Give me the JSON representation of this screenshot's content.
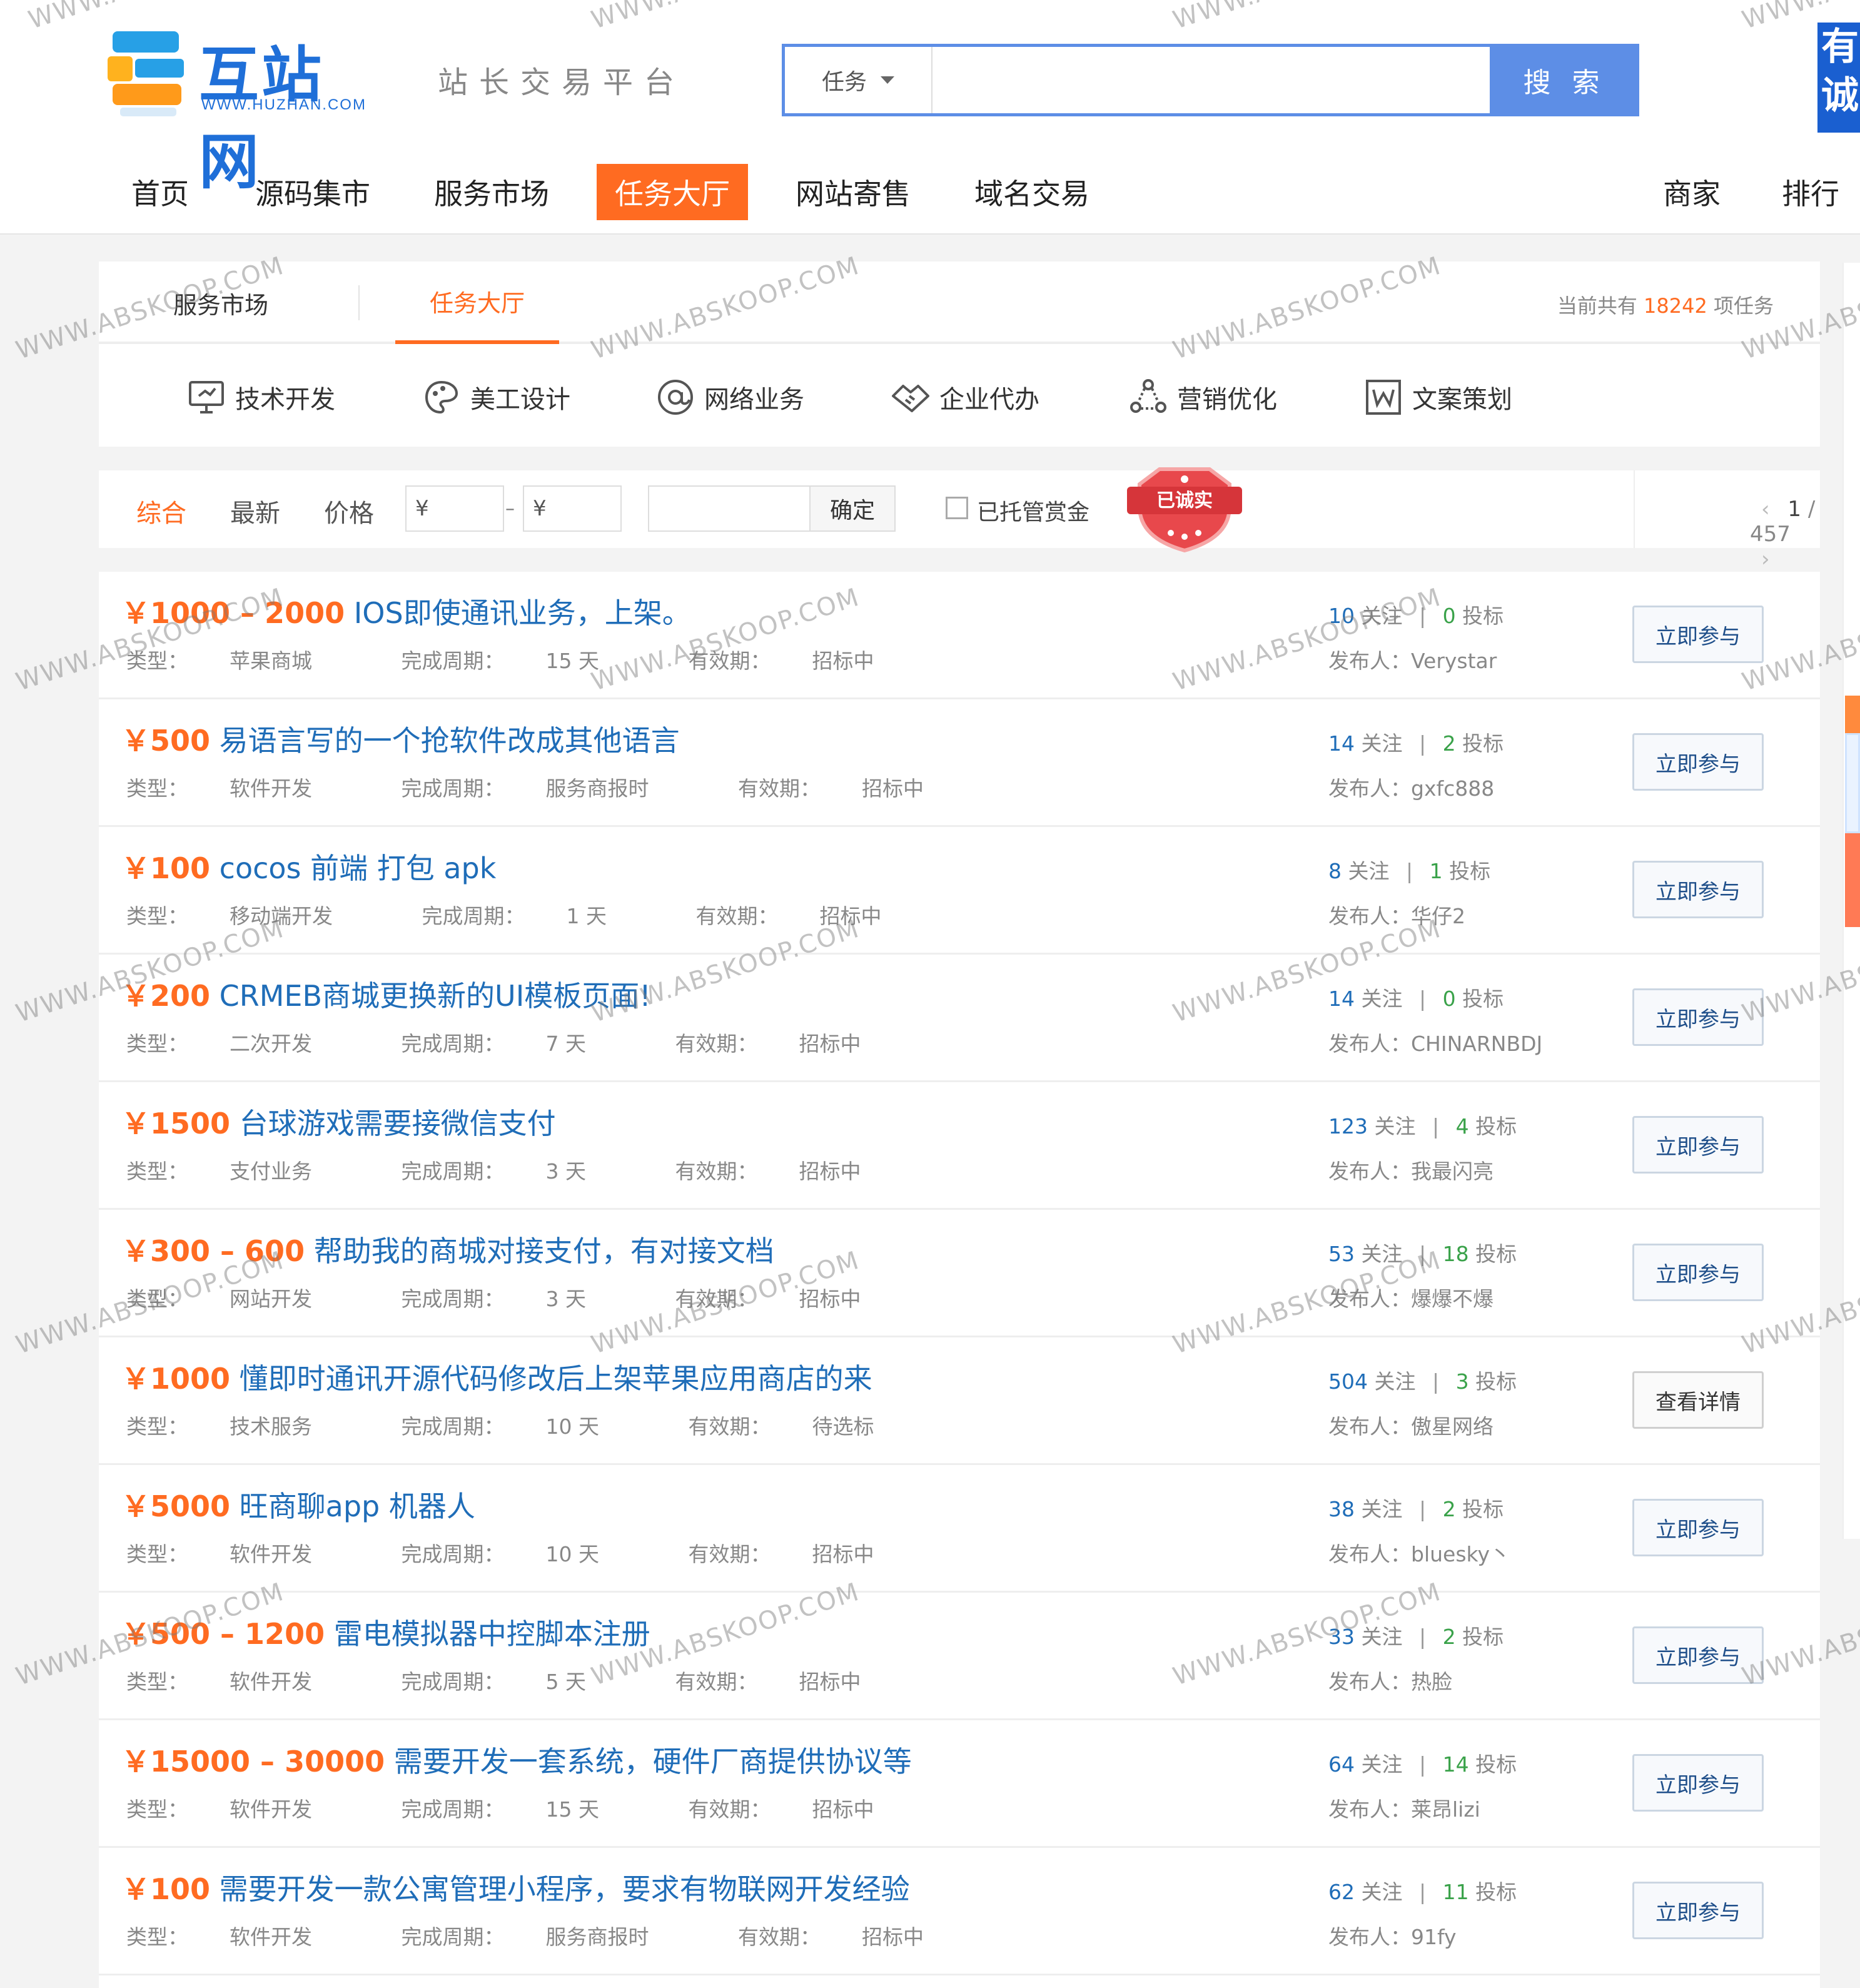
{
  "header": {
    "logo_cn": "互站网",
    "logo_en": "WWW.HUZHAN.COM",
    "slogan": "站长交易平台",
    "search_type": "任务",
    "search_placeholder": "",
    "search_button": "搜 索",
    "ad_text": "有诚"
  },
  "nav": [
    {
      "label": "首页"
    },
    {
      "label": "源码集市"
    },
    {
      "label": "服务市场"
    },
    {
      "label": "任务大厅"
    },
    {
      "label": "网站寄售"
    },
    {
      "label": "域名交易"
    },
    {
      "label": "商家"
    },
    {
      "label": "排行"
    }
  ],
  "tabs": {
    "service": "服务市场",
    "tasks": "任务大厅",
    "count_prefix": "当前共有",
    "count": "18242",
    "count_suffix": "项任务"
  },
  "categories": [
    {
      "label": "技术开发",
      "icon": "monitor-icon"
    },
    {
      "label": "美工设计",
      "icon": "palette-icon"
    },
    {
      "label": "网络业务",
      "icon": "at-icon"
    },
    {
      "label": "企业代办",
      "icon": "handshake-icon"
    },
    {
      "label": "营销优化",
      "icon": "network-icon"
    },
    {
      "label": "文案策划",
      "icon": "word-icon"
    }
  ],
  "filter": {
    "sort_all": "综合",
    "sort_new": "最新",
    "sort_price": "价格",
    "price_min": "¥",
    "price_max": "¥",
    "keyword": "",
    "confirm": "确定",
    "escrow_label": "已托管赏金",
    "seal_text": "已诚实",
    "page_current": "1",
    "page_sep": "/",
    "page_total": "457"
  },
  "labels": {
    "type": "类型：",
    "period": "完成周期：",
    "validity": "有效期：",
    "follow": "关注",
    "bid": "投标",
    "publisher": "发布人："
  },
  "tasks": [
    {
      "price": "￥1000 – 2000",
      "title": "IOS即使通讯业务，上架。",
      "type": "苹果商城",
      "period": "15 天",
      "validity": "招标中",
      "follows": "10",
      "bids": "0",
      "publisher": "Verystar",
      "button": "立即参与"
    },
    {
      "price": "￥500",
      "title": "易语言写的一个抢软件改成其他语言",
      "type": "软件开发",
      "period": "服务商报时",
      "validity": "招标中",
      "follows": "14",
      "bids": "2",
      "publisher": "gxfc888",
      "button": "立即参与"
    },
    {
      "price": "￥100",
      "title": "cocos 前端 打包 apk",
      "type": "移动端开发",
      "period": "1 天",
      "validity": "招标中",
      "follows": "8",
      "bids": "1",
      "publisher": "华仔2",
      "button": "立即参与"
    },
    {
      "price": "￥200",
      "title": "CRMEB商城更换新的UI模板页面!",
      "type": "二次开发",
      "period": "7 天",
      "validity": "招标中",
      "follows": "14",
      "bids": "0",
      "publisher": "CHINARNBDJ",
      "button": "立即参与"
    },
    {
      "price": "￥1500",
      "title": "台球游戏需要接微信支付",
      "type": "支付业务",
      "period": "3 天",
      "validity": "招标中",
      "follows": "123",
      "bids": "4",
      "publisher": "我最闪亮",
      "button": "立即参与"
    },
    {
      "price": "￥300 – 600",
      "title": "帮助我的商城对接支付，有对接文档",
      "type": "网站开发",
      "period": "3 天",
      "validity": "招标中",
      "follows": "53",
      "bids": "18",
      "publisher": "爆爆不爆",
      "button": "立即参与"
    },
    {
      "price": "￥1000",
      "title": "懂即时通讯开源代码修改后上架苹果应用商店的来",
      "type": "技术服务",
      "period": "10 天",
      "validity": "待选标",
      "follows": "504",
      "bids": "3",
      "publisher": "傲星网络",
      "button": "查看详情"
    },
    {
      "price": "￥5000",
      "title": "旺商聊app 机器人",
      "type": "软件开发",
      "period": "10 天",
      "validity": "招标中",
      "follows": "38",
      "bids": "2",
      "publisher": "bluesky丶",
      "button": "立即参与"
    },
    {
      "price": "￥500 – 1200",
      "title": "雷电模拟器中控脚本注册",
      "type": "软件开发",
      "period": "5 天",
      "validity": "招标中",
      "follows": "33",
      "bids": "2",
      "publisher": "热脸",
      "button": "立即参与"
    },
    {
      "price": "￥15000 – 30000",
      "title": "需要开发一套系统，硬件厂商提供协议等",
      "type": "软件开发",
      "period": "15 天",
      "validity": "招标中",
      "follows": "64",
      "bids": "14",
      "publisher": "莱昂lizi",
      "button": "立即参与"
    },
    {
      "price": "￥100",
      "title": "需要开发一款公寓管理小程序，要求有物联网开发经验",
      "type": "软件开发",
      "period": "服务商报时",
      "validity": "招标中",
      "follows": "62",
      "bids": "11",
      "publisher": "91fy",
      "button": "立即参与"
    }
  ],
  "watermark": "WWW.ABSKOOP.COM",
  "colors": {
    "accent": "#ff6b21",
    "link": "#1f6db8",
    "search": "#5d8ee6",
    "green": "#3aa24a"
  }
}
